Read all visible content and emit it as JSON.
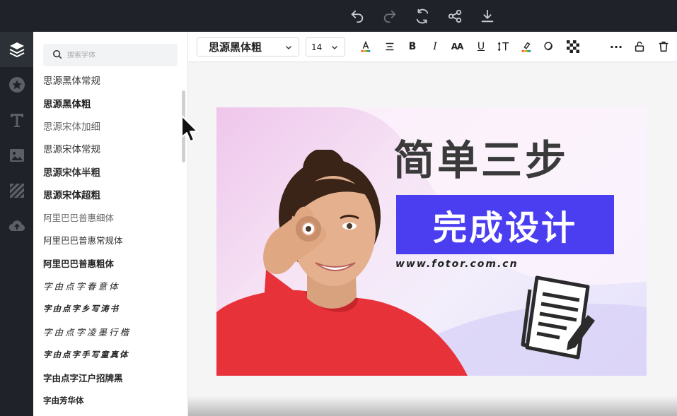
{
  "top_toolbar": {
    "icons": [
      "undo-icon",
      "redo-icon",
      "refresh-icon",
      "share-icon",
      "download-icon"
    ]
  },
  "left_rail": {
    "items": [
      "layers-icon",
      "star-icon",
      "text-icon",
      "image-icon",
      "pattern-icon",
      "upload-icon"
    ],
    "active": "layers-icon"
  },
  "font_panel": {
    "search_placeholder": "搜索字体",
    "fonts": [
      "思源黑体常规",
      "思源黑体粗",
      "思源宋体加细",
      "思源宋体常规",
      "思源宋体半粗",
      "思源宋体超粗",
      "阿里巴巴普惠细体",
      "阿里巴巴普惠常规体",
      "阿里巴巴普惠粗体",
      "字由点字春意体",
      "字由点字乡写涛书",
      "字由点字凌墨行楷",
      "字由点字手写童真体",
      "字由点字江户招牌黑",
      "字由芳华体"
    ]
  },
  "text_toolbar": {
    "font_family": "思源黑体粗",
    "font_size": "14",
    "buttons": [
      "font-color-icon",
      "align-icon",
      "bold-icon",
      "italic-icon",
      "letter-spacing-icon",
      "underline-icon",
      "line-height-icon",
      "highlight-icon",
      "effects-icon",
      "transparency-icon",
      "more-icon",
      "lock-icon",
      "delete-icon"
    ],
    "bold": "B",
    "italic": "I",
    "underline": "U",
    "letter_spacing": "AA",
    "more": "···"
  },
  "canvas": {
    "headline": "简单三步",
    "subheadline": "完成设计",
    "url": "www.fotor.com.cn",
    "colors": {
      "accent_box": "#4b3ef0",
      "headline": "#3a3a3a"
    }
  }
}
